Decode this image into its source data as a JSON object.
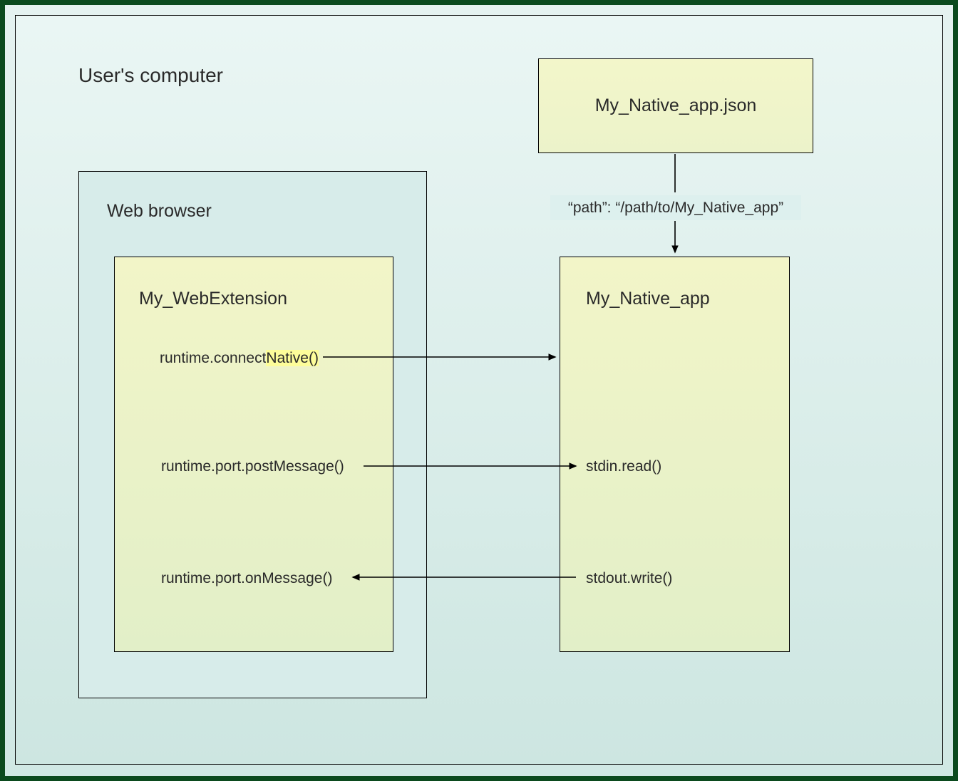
{
  "outer": {
    "label": "User's computer"
  },
  "browser": {
    "label": "Web browser"
  },
  "extension": {
    "title": "My_WebExtension",
    "api_connect": "runtime.connectNative()",
    "api_post": "runtime.port.postMessage()",
    "api_on": "runtime.port.onMessage()"
  },
  "manifest": {
    "filename": "My_Native_app.json",
    "path_entry": "“path”: “/path/to/My_Native_app”"
  },
  "native": {
    "title": "My_Native_app",
    "stdin": "stdin.read()",
    "stdout": "stdout.write()"
  }
}
